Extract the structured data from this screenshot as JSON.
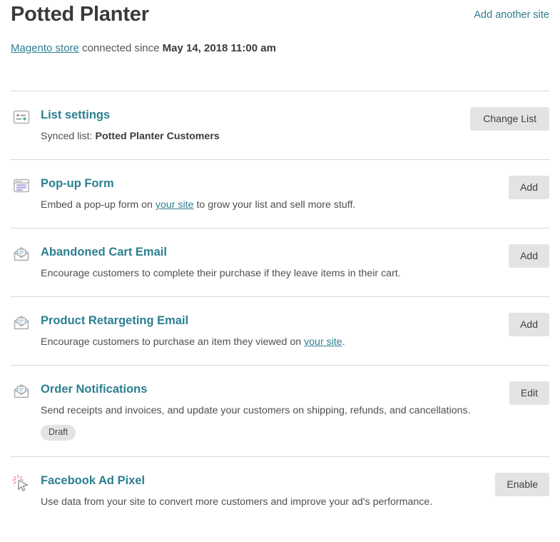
{
  "header": {
    "title": "Potted Planter",
    "add_site_label": "Add another site",
    "store_link": "Magento store",
    "connected_text": "connected since",
    "connected_date": "May 14, 2018 11:00 am"
  },
  "colors": {
    "link_teal": "#2c7f91",
    "title_dark": "#3b3b3b",
    "button_gray": "#e3e3e3",
    "divider": "#d8d8d8",
    "badge_gray": "#e3e3e3",
    "accent_green": "#2fc18c",
    "accent_purple": "#b3a2e0",
    "accent_blue": "#8ec9e8",
    "accent_pink": "#f48fb1"
  },
  "rows": [
    {
      "icon": "list-settings-icon",
      "title": "List settings",
      "desc_prefix": "Synced list: ",
      "desc_strong": "Potted Planter Customers",
      "desc_middle": "",
      "desc_link": "",
      "desc_suffix": "",
      "badge": "",
      "button": "Change List"
    },
    {
      "icon": "popup-form-icon",
      "title": "Pop-up Form",
      "desc_prefix": "Embed a pop-up form on ",
      "desc_strong": "",
      "desc_middle": "",
      "desc_link": "your site",
      "desc_suffix": " to grow your list and sell more stuff.",
      "badge": "",
      "button": "Add"
    },
    {
      "icon": "abandoned-cart-email-icon",
      "title": "Abandoned Cart Email",
      "desc_prefix": "Encourage customers to complete their purchase if they leave items in their cart.",
      "desc_strong": "",
      "desc_middle": "",
      "desc_link": "",
      "desc_suffix": "",
      "badge": "",
      "button": "Add"
    },
    {
      "icon": "product-retargeting-email-icon",
      "title": "Product Retargeting Email",
      "desc_prefix": "Encourage customers to purchase an item they viewed on ",
      "desc_strong": "",
      "desc_middle": "",
      "desc_link": "your site",
      "desc_suffix": ".",
      "badge": "",
      "button": "Add"
    },
    {
      "icon": "order-notifications-icon",
      "title": "Order Notifications",
      "desc_prefix": "Send receipts and invoices, and update your customers on shipping, refunds, and cancellations.",
      "desc_strong": "",
      "desc_middle": "",
      "desc_link": "",
      "desc_suffix": "",
      "badge": "Draft",
      "button": "Edit"
    },
    {
      "icon": "facebook-ad-pixel-icon",
      "title": "Facebook Ad Pixel",
      "desc_prefix": "Use data from your site to convert more customers and improve your ad's performance.",
      "desc_strong": "",
      "desc_middle": "",
      "desc_link": "",
      "desc_suffix": "",
      "badge": "",
      "button": "Enable"
    }
  ]
}
